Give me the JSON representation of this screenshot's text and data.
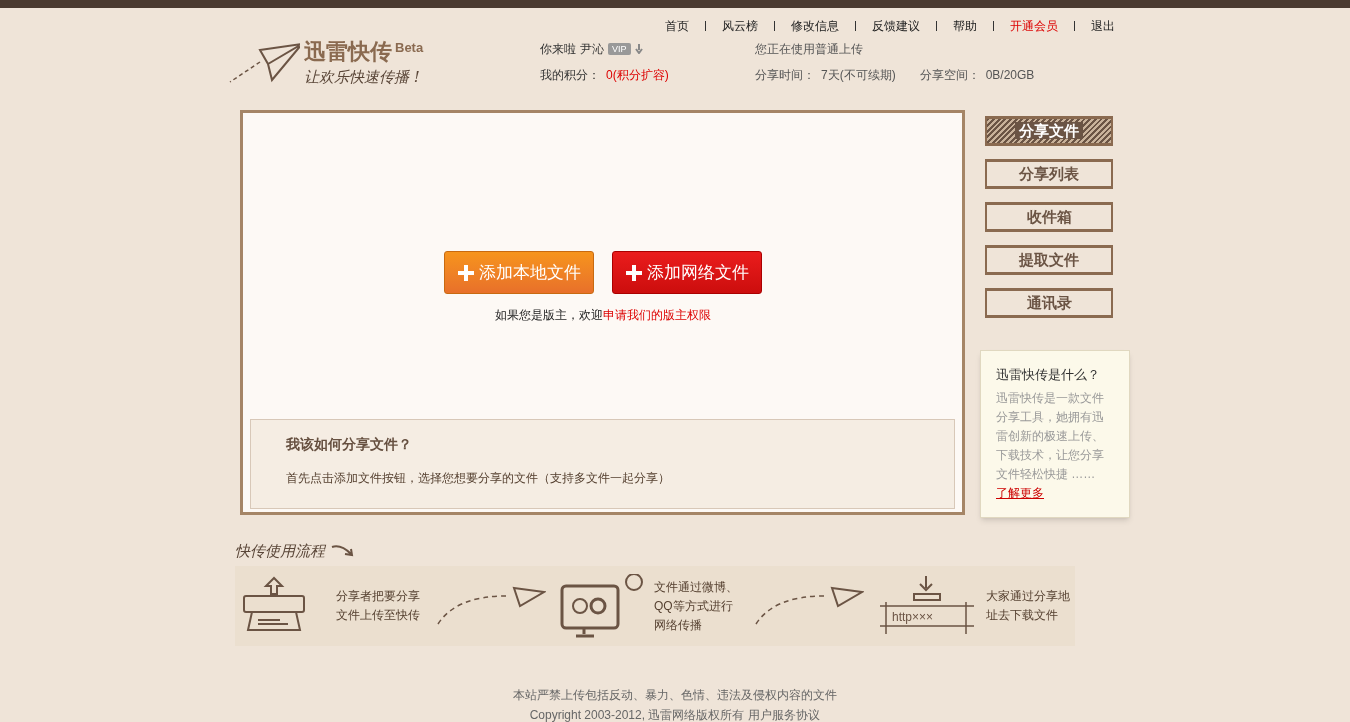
{
  "top_nav": [
    {
      "label": "首页",
      "kind": "link"
    },
    {
      "label": "风云榜",
      "kind": "link"
    },
    {
      "label": "修改信息",
      "kind": "link"
    },
    {
      "label": "反馈建议",
      "kind": "link"
    },
    {
      "label": "帮助",
      "kind": "link"
    },
    {
      "label": "开通会员",
      "kind": "promo"
    },
    {
      "label": "退出",
      "kind": "link"
    }
  ],
  "logo": {
    "title": "迅雷快传",
    "badge": "Beta",
    "slogan": "让欢乐快速传播 !"
  },
  "user": {
    "greeting": "你来啦",
    "name": "尹沁",
    "vip": "VIP",
    "points_label": "我的积分：",
    "points": "0(积分扩容)"
  },
  "account": {
    "mode": "您正在使用普通上传",
    "time_label": "分享时间：",
    "time": "7天(不可续期)",
    "space_label": "分享空间：",
    "space": "0B/20GB"
  },
  "main": {
    "buttons": [
      {
        "label": "添加本地文件",
        "kind": "local"
      },
      {
        "label": "添加网络文件",
        "kind": "web"
      }
    ],
    "notice": "如果您是版主，欢迎",
    "notice_link": "申请我们的版主权限"
  },
  "help": {
    "title": "我该如何分享文件？",
    "text": "首先点击添加文件按钮，选择您想要分享的文件（支持多文件一起分享）"
  },
  "side_nav": [
    {
      "label": "分享文件",
      "selected": true
    },
    {
      "label": "分享列表",
      "selected": false
    },
    {
      "label": "收件箱",
      "selected": false
    },
    {
      "label": "提取文件",
      "selected": false
    },
    {
      "label": "通讯录",
      "selected": false
    }
  ],
  "about": {
    "title": "迅雷快传是什么？",
    "text": "迅雷快传是一款文件分享工具，她拥有迅雷创新的极速上传、下载技术，让您分享文件轻松快捷 ……",
    "link": "了解更多"
  },
  "flow": {
    "title": "快传使用流程",
    "steps": [
      {
        "kind": "upload",
        "text": "分享者把要分享文件上传至快传"
      },
      {
        "kind": "share",
        "text": "文件通过微博、QQ等方式进行网络传播"
      },
      {
        "kind": "download",
        "text": "大家通过分享地址去下载文件",
        "url": "http×××"
      }
    ]
  },
  "footer": {
    "notice": "本站严禁上传包括反动、暴力、色情、违法及侵权内容的文件",
    "copyright": "Copyright 2003-2012, 迅雷网络版权所有",
    "link": "用户服务协议"
  }
}
